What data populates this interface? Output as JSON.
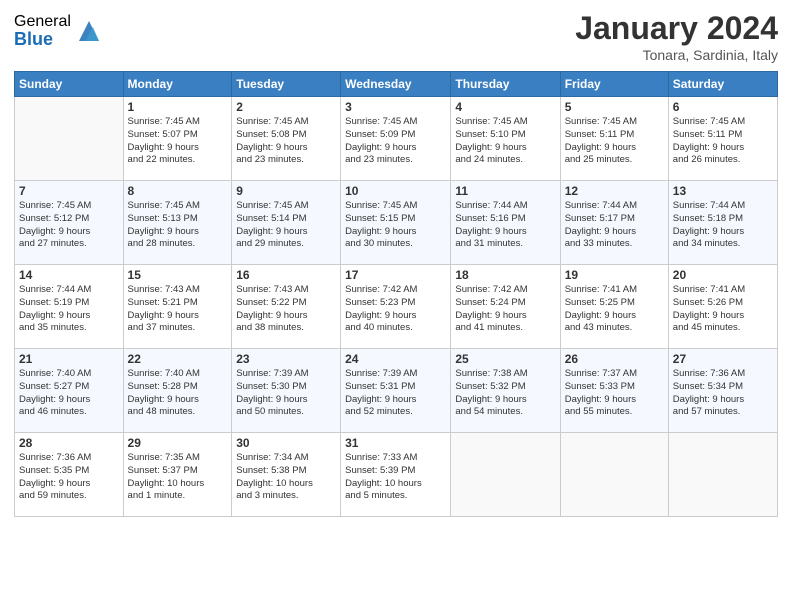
{
  "logo": {
    "general": "General",
    "blue": "Blue"
  },
  "title": "January 2024",
  "subtitle": "Tonara, Sardinia, Italy",
  "weekdays": [
    "Sunday",
    "Monday",
    "Tuesday",
    "Wednesday",
    "Thursday",
    "Friday",
    "Saturday"
  ],
  "weeks": [
    [
      {
        "day": "",
        "info": ""
      },
      {
        "day": "1",
        "info": "Sunrise: 7:45 AM\nSunset: 5:07 PM\nDaylight: 9 hours\nand 22 minutes."
      },
      {
        "day": "2",
        "info": "Sunrise: 7:45 AM\nSunset: 5:08 PM\nDaylight: 9 hours\nand 23 minutes."
      },
      {
        "day": "3",
        "info": "Sunrise: 7:45 AM\nSunset: 5:09 PM\nDaylight: 9 hours\nand 23 minutes."
      },
      {
        "day": "4",
        "info": "Sunrise: 7:45 AM\nSunset: 5:10 PM\nDaylight: 9 hours\nand 24 minutes."
      },
      {
        "day": "5",
        "info": "Sunrise: 7:45 AM\nSunset: 5:11 PM\nDaylight: 9 hours\nand 25 minutes."
      },
      {
        "day": "6",
        "info": "Sunrise: 7:45 AM\nSunset: 5:11 PM\nDaylight: 9 hours\nand 26 minutes."
      }
    ],
    [
      {
        "day": "7",
        "info": "Sunrise: 7:45 AM\nSunset: 5:12 PM\nDaylight: 9 hours\nand 27 minutes."
      },
      {
        "day": "8",
        "info": "Sunrise: 7:45 AM\nSunset: 5:13 PM\nDaylight: 9 hours\nand 28 minutes."
      },
      {
        "day": "9",
        "info": "Sunrise: 7:45 AM\nSunset: 5:14 PM\nDaylight: 9 hours\nand 29 minutes."
      },
      {
        "day": "10",
        "info": "Sunrise: 7:45 AM\nSunset: 5:15 PM\nDaylight: 9 hours\nand 30 minutes."
      },
      {
        "day": "11",
        "info": "Sunrise: 7:44 AM\nSunset: 5:16 PM\nDaylight: 9 hours\nand 31 minutes."
      },
      {
        "day": "12",
        "info": "Sunrise: 7:44 AM\nSunset: 5:17 PM\nDaylight: 9 hours\nand 33 minutes."
      },
      {
        "day": "13",
        "info": "Sunrise: 7:44 AM\nSunset: 5:18 PM\nDaylight: 9 hours\nand 34 minutes."
      }
    ],
    [
      {
        "day": "14",
        "info": "Sunrise: 7:44 AM\nSunset: 5:19 PM\nDaylight: 9 hours\nand 35 minutes."
      },
      {
        "day": "15",
        "info": "Sunrise: 7:43 AM\nSunset: 5:21 PM\nDaylight: 9 hours\nand 37 minutes."
      },
      {
        "day": "16",
        "info": "Sunrise: 7:43 AM\nSunset: 5:22 PM\nDaylight: 9 hours\nand 38 minutes."
      },
      {
        "day": "17",
        "info": "Sunrise: 7:42 AM\nSunset: 5:23 PM\nDaylight: 9 hours\nand 40 minutes."
      },
      {
        "day": "18",
        "info": "Sunrise: 7:42 AM\nSunset: 5:24 PM\nDaylight: 9 hours\nand 41 minutes."
      },
      {
        "day": "19",
        "info": "Sunrise: 7:41 AM\nSunset: 5:25 PM\nDaylight: 9 hours\nand 43 minutes."
      },
      {
        "day": "20",
        "info": "Sunrise: 7:41 AM\nSunset: 5:26 PM\nDaylight: 9 hours\nand 45 minutes."
      }
    ],
    [
      {
        "day": "21",
        "info": "Sunrise: 7:40 AM\nSunset: 5:27 PM\nDaylight: 9 hours\nand 46 minutes."
      },
      {
        "day": "22",
        "info": "Sunrise: 7:40 AM\nSunset: 5:28 PM\nDaylight: 9 hours\nand 48 minutes."
      },
      {
        "day": "23",
        "info": "Sunrise: 7:39 AM\nSunset: 5:30 PM\nDaylight: 9 hours\nand 50 minutes."
      },
      {
        "day": "24",
        "info": "Sunrise: 7:39 AM\nSunset: 5:31 PM\nDaylight: 9 hours\nand 52 minutes."
      },
      {
        "day": "25",
        "info": "Sunrise: 7:38 AM\nSunset: 5:32 PM\nDaylight: 9 hours\nand 54 minutes."
      },
      {
        "day": "26",
        "info": "Sunrise: 7:37 AM\nSunset: 5:33 PM\nDaylight: 9 hours\nand 55 minutes."
      },
      {
        "day": "27",
        "info": "Sunrise: 7:36 AM\nSunset: 5:34 PM\nDaylight: 9 hours\nand 57 minutes."
      }
    ],
    [
      {
        "day": "28",
        "info": "Sunrise: 7:36 AM\nSunset: 5:35 PM\nDaylight: 9 hours\nand 59 minutes."
      },
      {
        "day": "29",
        "info": "Sunrise: 7:35 AM\nSunset: 5:37 PM\nDaylight: 10 hours\nand 1 minute."
      },
      {
        "day": "30",
        "info": "Sunrise: 7:34 AM\nSunset: 5:38 PM\nDaylight: 10 hours\nand 3 minutes."
      },
      {
        "day": "31",
        "info": "Sunrise: 7:33 AM\nSunset: 5:39 PM\nDaylight: 10 hours\nand 5 minutes."
      },
      {
        "day": "",
        "info": ""
      },
      {
        "day": "",
        "info": ""
      },
      {
        "day": "",
        "info": ""
      }
    ]
  ]
}
